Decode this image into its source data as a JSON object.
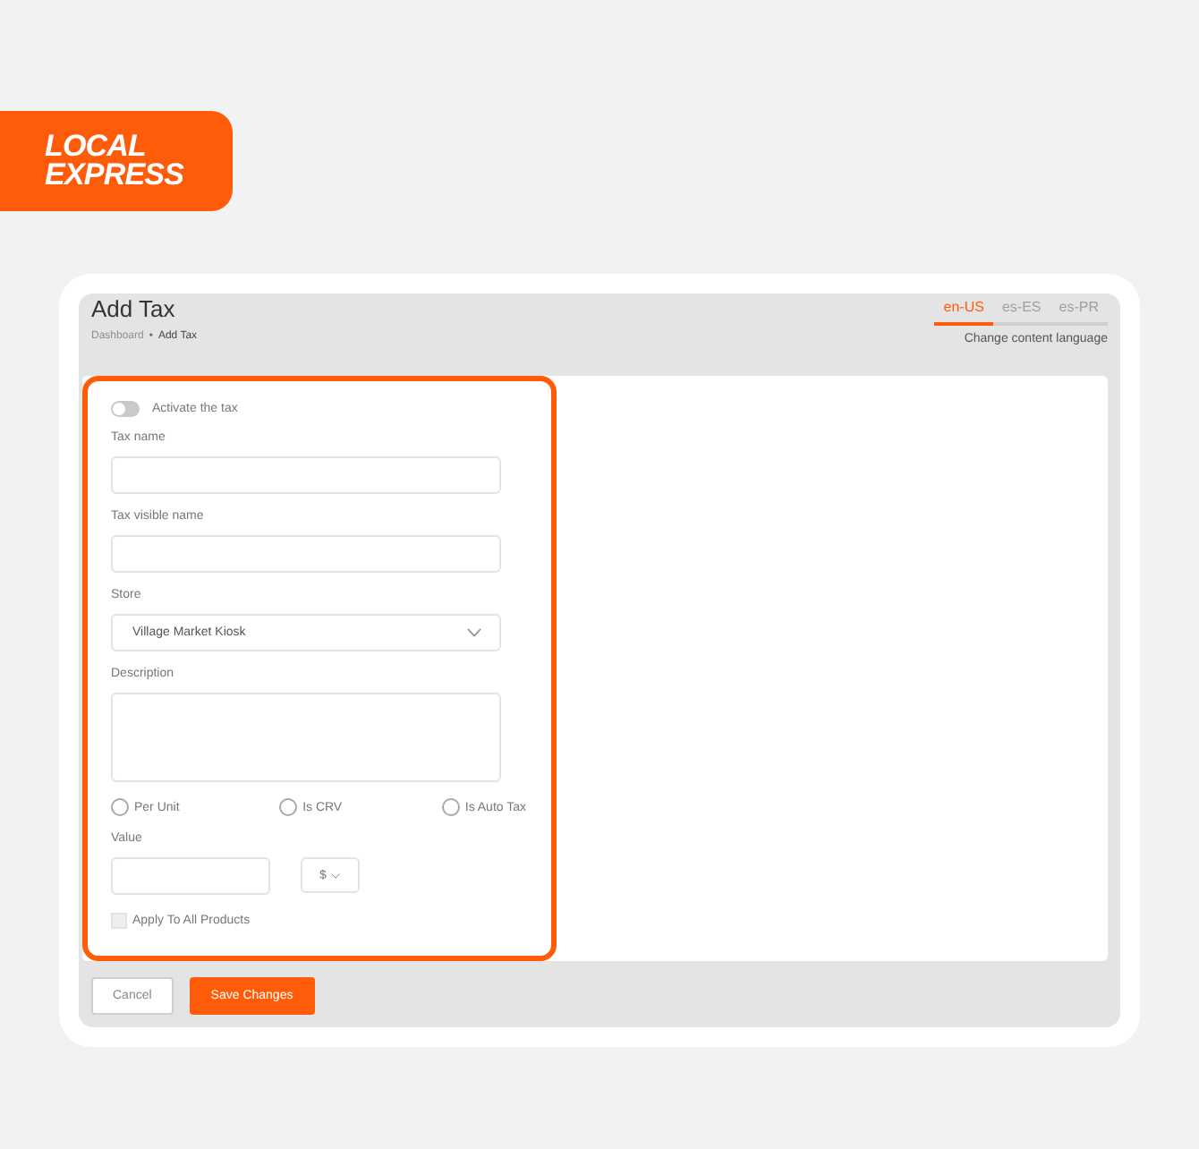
{
  "logo": {
    "lines": [
      "LOCAL",
      "EXPRESS"
    ]
  },
  "header": {
    "title": "Add Tax",
    "breadcrumb": [
      {
        "label": "Dashboard",
        "current": false
      },
      {
        "label": "Add Tax",
        "current": true
      }
    ],
    "separator": "•"
  },
  "language_tabs": [
    {
      "label": "en-US",
      "selected": true
    },
    {
      "label": "es-ES",
      "selected": false
    },
    {
      "label": "es-PR",
      "selected": false
    }
  ],
  "language_hint": "Change content language",
  "form": {
    "highlighted": true,
    "toggle": {
      "label": "Activate the tax",
      "on": false
    },
    "fields": [
      {
        "kind": "text",
        "label": "Tax name"
      },
      {
        "kind": "text",
        "label": "Tax visible name"
      },
      {
        "kind": "select",
        "label": "Store",
        "value": "Village Market Kiosk"
      },
      {
        "kind": "textarea",
        "label": "Description"
      }
    ],
    "radios": [
      {
        "label": "Per Unit",
        "selected": false
      },
      {
        "label": "Is CRV",
        "selected": false
      },
      {
        "label": "Is Auto Tax",
        "selected": false
      }
    ],
    "value_field": {
      "label": "Value",
      "currency": "$"
    },
    "checkbox": {
      "label": "Apply To All Products",
      "checked": false
    }
  },
  "buttons": [
    {
      "kind": "secondary",
      "label": "Cancel"
    },
    {
      "kind": "primary",
      "label": "Save Changes"
    }
  ]
}
